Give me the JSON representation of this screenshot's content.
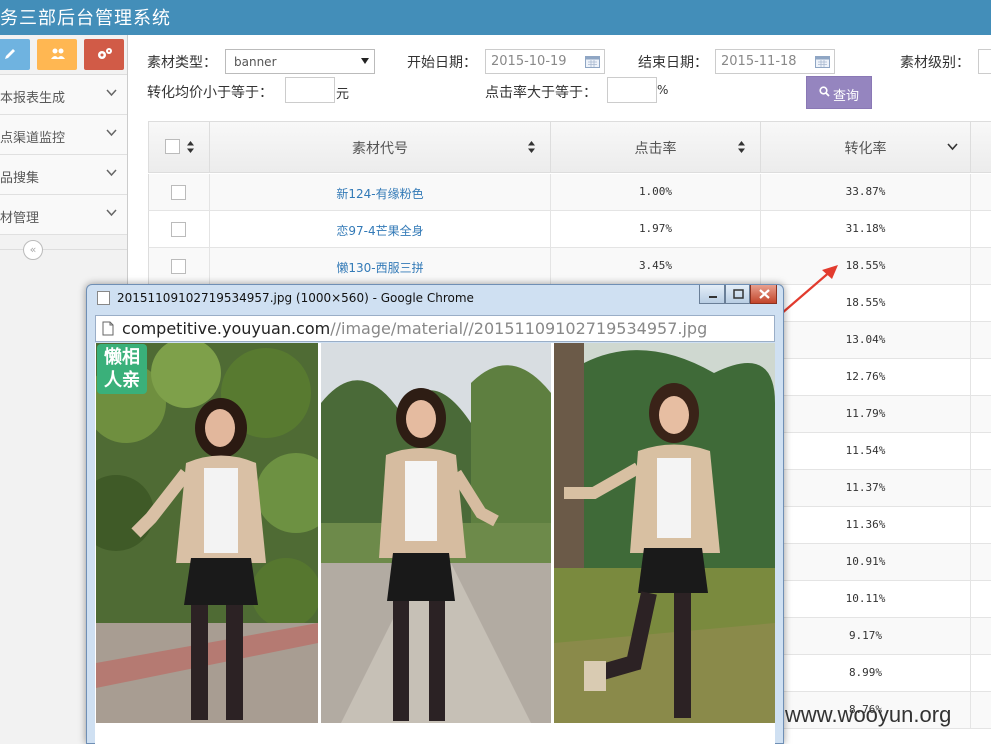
{
  "header": {
    "title": "务三部后台管理系统"
  },
  "sidebar": {
    "items": [
      {
        "label": "本报表生成"
      },
      {
        "label": "点渠道监控"
      },
      {
        "label": "品搜集"
      },
      {
        "label": "材管理"
      }
    ],
    "collapse_glyph": "«"
  },
  "filters": {
    "type_label": "素材类型：",
    "type_value": "banner",
    "start_label": "开始日期：",
    "start_value": "2015-10-19",
    "end_label": "结束日期：",
    "end_value": "2015-11-18",
    "level_label": "素材级别：",
    "conv_label": "转化均价小于等于：",
    "conv_unit": "元",
    "ctr_label": "点击率大于等于：",
    "ctr_unit": "%",
    "query_label": "查询"
  },
  "table": {
    "columns": [
      "素材代号",
      "点击率",
      "转化率"
    ],
    "rows": [
      {
        "code": "新124-有缘粉色",
        "ctr": "1.00%",
        "conv": "33.87%"
      },
      {
        "code": "恋97-4芒果全身",
        "ctr": "1.97%",
        "conv": "31.18%"
      },
      {
        "code": "懒130-西服三拼",
        "ctr": "3.45%",
        "conv": "18.55%"
      },
      {
        "code": "",
        "ctr": "",
        "conv": "18.55%"
      },
      {
        "code": "",
        "ctr": "",
        "conv": "13.04%"
      },
      {
        "code": "",
        "ctr": "",
        "conv": "12.76%"
      },
      {
        "code": "",
        "ctr": "",
        "conv": "11.79%"
      },
      {
        "code": "",
        "ctr": "",
        "conv": "11.54%"
      },
      {
        "code": "",
        "ctr": "",
        "conv": "11.37%"
      },
      {
        "code": "",
        "ctr": "",
        "conv": "11.36%"
      },
      {
        "code": "",
        "ctr": "",
        "conv": "10.91%"
      },
      {
        "code": "",
        "ctr": "",
        "conv": "10.11%"
      },
      {
        "code": "",
        "ctr": "",
        "conv": "9.17%"
      },
      {
        "code": "",
        "ctr": "",
        "conv": "8.99%"
      },
      {
        "code": "",
        "ctr": "",
        "conv": "8.76%"
      }
    ]
  },
  "popup": {
    "title": "20151109102719534957.jpg (1000×560) - Google Chrome",
    "url_host": "competitive.youyuan.com",
    "url_path": "//image/material//20151109102719534957.jpg",
    "brand_line1": "懒相",
    "brand_line2": "人亲"
  },
  "watermark": "www.wooyun.org",
  "colors": {
    "header": "#438eb9",
    "query_button": "#9585bf",
    "link": "#337ab7",
    "annotation": "#e23b2e"
  }
}
